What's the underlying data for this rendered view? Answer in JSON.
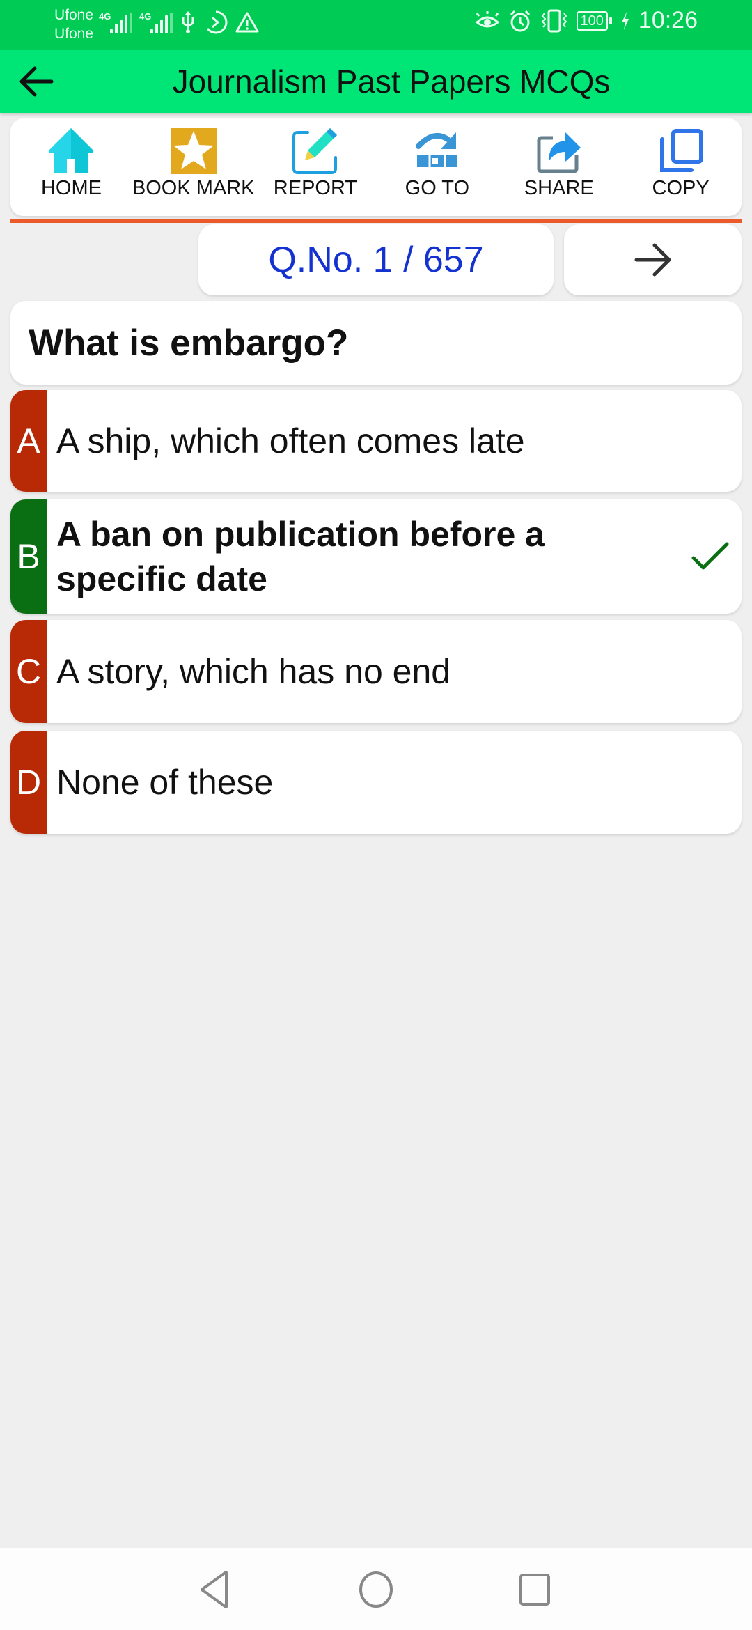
{
  "status_bar": {
    "carrier_1": "Ufone",
    "carrier_2": "Ufone",
    "network_1": "4G",
    "network_2": "4G",
    "battery": "100",
    "time": "10:26",
    "icons": [
      "signal-icon",
      "signal-icon",
      "usb-icon",
      "data-saver-icon",
      "warning-icon",
      "eye-comfort-icon",
      "alarm-icon",
      "vibrate-icon",
      "battery-icon",
      "charging-icon"
    ]
  },
  "app_bar": {
    "title": "Journalism Past Papers MCQs",
    "back_icon": "arrow-left-icon"
  },
  "toolbar": {
    "items": [
      {
        "label": "HOME",
        "icon": "home-icon"
      },
      {
        "label": "BOOK MARK",
        "icon": "bookmark-star-icon"
      },
      {
        "label": "REPORT",
        "icon": "edit-report-icon"
      },
      {
        "label": "GO TO",
        "icon": "goto-icon"
      },
      {
        "label": "SHARE",
        "icon": "share-icon"
      },
      {
        "label": "COPY",
        "icon": "copy-icon"
      }
    ]
  },
  "question_nav": {
    "label": "Q.No. 1 / 657",
    "current": 1,
    "total": 657,
    "next_icon": "arrow-right-icon"
  },
  "question": {
    "text": "What is embargo?"
  },
  "options": [
    {
      "letter": "A",
      "text": "A ship, which often comes late",
      "correct": false
    },
    {
      "letter": "B",
      "text": "A ban on publication before a specific date",
      "correct": true
    },
    {
      "letter": "C",
      "text": "A story, which has no end",
      "correct": false
    },
    {
      "letter": "D",
      "text": "None of these",
      "correct": false
    }
  ],
  "colors": {
    "status_bar": "#00cc55",
    "app_bar": "#00e676",
    "divider": "#ea5a2a",
    "wrong_option": "#b82a06",
    "correct_option": "#0a6e12",
    "question_number": "#1432d0"
  },
  "nav_bar": {
    "buttons": [
      "back-nav-icon",
      "home-nav-icon",
      "recents-nav-icon"
    ]
  }
}
